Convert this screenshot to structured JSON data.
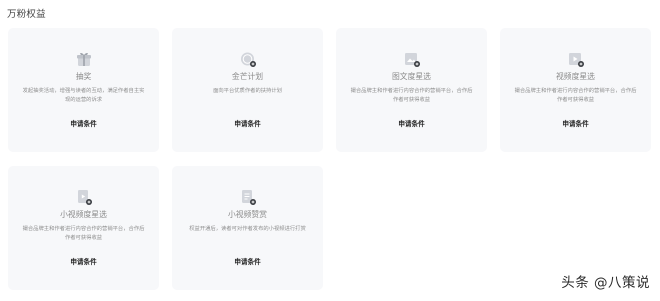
{
  "section": {
    "title": "万粉权益"
  },
  "cards": [
    {
      "title": "抽奖",
      "desc": "发起抽奖活动，增强与读者的互动，满足作者自主实现的运营的诉求",
      "apply_label": "申请条件",
      "icon": "gift-icon"
    },
    {
      "title": "金芒计划",
      "desc": "面向平台优质作者的扶持计划",
      "apply_label": "申请条件",
      "icon": "coin-icon"
    },
    {
      "title": "图文度星选",
      "desc": "撮合品牌主和作者进行内容合作的营销平台，合作后作者可获得收益",
      "apply_label": "申请条件",
      "icon": "image-doc-icon"
    },
    {
      "title": "视频度星选",
      "desc": "撮合品牌主和作者进行内容合作的营销平台，合作后作者可获得收益",
      "apply_label": "申请条件",
      "icon": "video-doc-icon"
    },
    {
      "title": "小视频度星选",
      "desc": "撮合品牌主和作者进行内容合作的营销平台，合作后作者可获得收益",
      "apply_label": "申请条件",
      "icon": "short-video-doc-icon"
    },
    {
      "title": "小视频赞赏",
      "desc": "权益开通后，读者可对作者发布的小视频进行打赏",
      "apply_label": "申请条件",
      "icon": "reward-doc-icon"
    }
  ],
  "watermark": {
    "text": "头条 @八策说"
  }
}
